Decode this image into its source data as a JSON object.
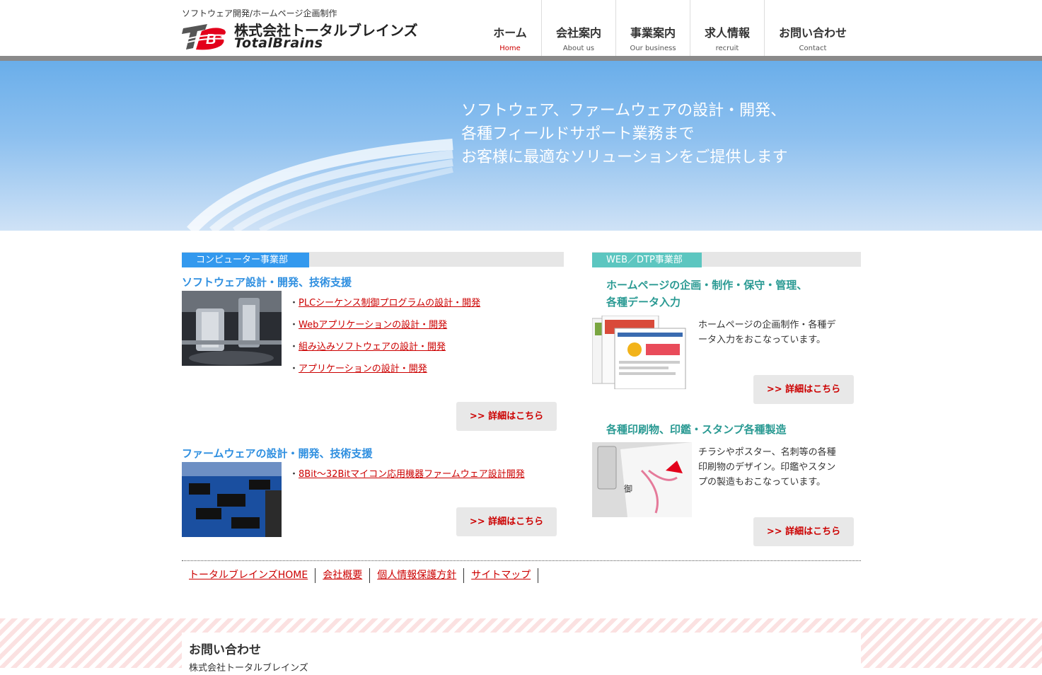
{
  "header": {
    "tagline": "ソフトウェア開発/ホームページ企画制作",
    "company_name": "株式会社トータルブレインズ",
    "brand_name": "TotalBrains"
  },
  "nav": {
    "items": [
      {
        "label": "ホーム",
        "sub": "Home",
        "active": true
      },
      {
        "label": "会社案内",
        "sub": "About us"
      },
      {
        "label": "事業案内",
        "sub": "Our business"
      },
      {
        "label": "求人情報",
        "sub": "recruit"
      },
      {
        "label": "お問い合わせ",
        "sub": "Contact"
      }
    ]
  },
  "hero": {
    "lines": [
      "ソフトウェア、ファームウェアの設計・開発、",
      "各種フィールドサポート業務まで",
      "お客様に最適なソリューションをご提供します"
    ]
  },
  "computer": {
    "section_label": "コンピューター事業部",
    "software": {
      "heading": "ソフトウェア設計・開発、技術支援",
      "items": [
        "PLCシーケンス制御プログラムの設計・開発",
        "Webアプリケーションの設計・開発",
        "組み込みソフトウェアの設計・開発",
        "アプリケーションの設計・開発"
      ],
      "button": ">> 詳細はこちら"
    },
    "firmware": {
      "heading": "ファームウェアの設計・開発、技術支援",
      "items": [
        "8Bit～32Bitマイコン応用機器ファームウェア設計開発"
      ],
      "button": ">> 詳細はこちら"
    }
  },
  "web": {
    "section_label": "WEB／DTP事業部",
    "homepage": {
      "heading_line1": "ホームページの企画・制作・保守・管理、",
      "heading_line2": "各種データ入力",
      "desc_line1": "ホームページの企画制作・各種デ",
      "desc_line2": "ータ入力をおこなっています。",
      "button": ">> 詳細はこちら"
    },
    "print": {
      "heading": "各種印刷物、印鑑・スタンプ各種製造",
      "desc_line1": "チラシやポスター、名刺等の各種",
      "desc_line2": "印刷物のデザイン。印鑑やスタン",
      "desc_line3": "プの製造もおこなっています。",
      "button": ">> 詳細はこちら"
    }
  },
  "footer_links": [
    "トータルブレインズHOME",
    "会社概要",
    "個人情報保護方針",
    "サイトマップ"
  ],
  "contact": {
    "title": "お問い合わせ",
    "company": "株式会社トータルブレインズ"
  },
  "colors": {
    "accent_red": "#e3001b",
    "link_red": "#cc0000",
    "computer_blue": "#3399ee",
    "web_teal": "#5cc6c0"
  }
}
